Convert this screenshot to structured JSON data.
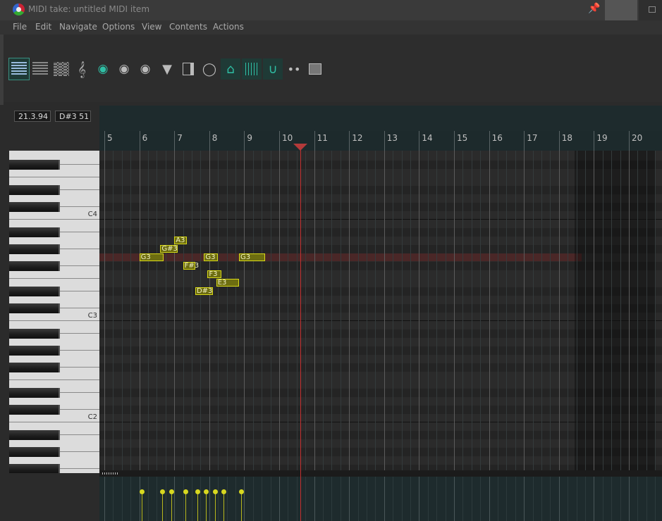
{
  "window": {
    "title": "MIDI take: untitled MIDI item"
  },
  "menu": [
    "File",
    "Edit",
    "Navigate",
    "Options",
    "View",
    "Contents",
    "Actions"
  ],
  "toolbar": {
    "buttons": [
      {
        "name": "view-list-icon",
        "active": true
      },
      {
        "name": "view-grid-icon",
        "active": false
      },
      {
        "name": "view-matrix-icon",
        "active": false
      },
      {
        "name": "treble-clef-icon",
        "active": false
      },
      {
        "name": "palette-color-icon",
        "active": false
      },
      {
        "name": "palette-color-2-icon",
        "active": false
      },
      {
        "name": "palette-color-3-icon",
        "active": false
      },
      {
        "name": "filter-icon",
        "active": false
      },
      {
        "name": "panel-toggle-icon",
        "active": false
      },
      {
        "name": "quantize-icon",
        "active": false
      },
      {
        "name": "link-icon",
        "active": true
      },
      {
        "name": "grid-toggle-icon",
        "active": true
      },
      {
        "name": "snap-magnet-icon",
        "active": true
      },
      {
        "name": "step-input-icon",
        "active": false
      },
      {
        "name": "insert-icon",
        "active": false
      }
    ]
  },
  "info": {
    "position": "21.3.94",
    "note": "D#3  51"
  },
  "ruler": {
    "labels": [
      "5",
      "6",
      "7",
      "8",
      "9",
      "10",
      "11",
      "12",
      "13",
      "14",
      "15",
      "16",
      "17",
      "18",
      "19",
      "20"
    ]
  },
  "piano": {
    "octave_labels": [
      "C4",
      "C3",
      "C2"
    ]
  },
  "notes": [
    {
      "label": "A3",
      "pitch": 57,
      "start": 7.0,
      "end": 7.35
    },
    {
      "label": "G#3",
      "pitch": 56,
      "start": 6.6,
      "end": 7.1
    },
    {
      "label": "G3",
      "pitch": 55,
      "start": 6.0,
      "end": 6.7
    },
    {
      "label": "G3",
      "pitch": 55,
      "start": 7.85,
      "end": 8.25
    },
    {
      "label": "G3",
      "pitch": 55,
      "start": 8.85,
      "end": 9.6
    },
    {
      "label": "F#3",
      "pitch": 54,
      "start": 7.25,
      "end": 7.6
    },
    {
      "label": "F3",
      "pitch": 53,
      "start": 7.95,
      "end": 8.35
    },
    {
      "label": "E3",
      "pitch": 52,
      "start": 8.2,
      "end": 8.85
    },
    {
      "label": "D#3",
      "pitch": 51,
      "start": 7.6,
      "end": 8.1
    }
  ],
  "cc_events": [
    6.0,
    6.6,
    6.85,
    7.25,
    7.6,
    7.85,
    8.1,
    8.35,
    8.85
  ],
  "playhead_bar": 10.6,
  "highlight_pitch": 55,
  "item_end_bar": 18.45
}
